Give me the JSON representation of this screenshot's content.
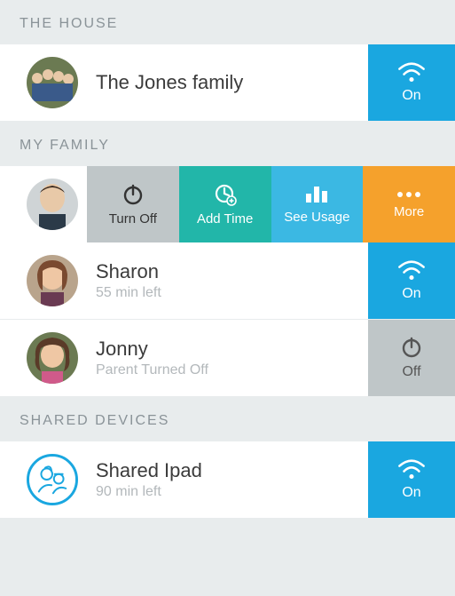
{
  "sections": {
    "house": {
      "header": "THE HOUSE"
    },
    "family": {
      "header": "MY FAMILY"
    },
    "shared": {
      "header": "SHARED DEVICES"
    }
  },
  "house_row": {
    "title": "The Jones family",
    "status_label": "On",
    "status_state": "on"
  },
  "family_actions": {
    "turn_off": "Turn Off",
    "add_time": "Add Time",
    "see_usage": "See Usage",
    "more": "More"
  },
  "family_rows": [
    {
      "title": "Sharon",
      "sub": "55 min left",
      "status_label": "On",
      "status_state": "on"
    },
    {
      "title": "Jonny",
      "sub": "Parent Turned Off",
      "status_label": "Off",
      "status_state": "off"
    }
  ],
  "shared_rows": [
    {
      "title": "Shared Ipad",
      "sub": "90 min left",
      "status_label": "On",
      "status_state": "on"
    }
  ],
  "colors": {
    "accent_blue": "#1aa7e0",
    "action_gray": "#bfc6c8",
    "action_teal": "#22b6a9",
    "action_blue": "#3bb8e3",
    "action_orange": "#f5a12c"
  }
}
